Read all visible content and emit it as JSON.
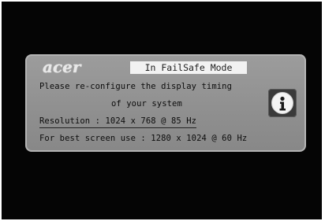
{
  "brand": {
    "logo_text": "acer"
  },
  "osd": {
    "mode_banner": "In FailSafe Mode",
    "message_line1": "Please re-configure the display timing",
    "message_line2": "of your system",
    "resolution_text": "Resolution : 1024 x 768 @ 85 Hz",
    "recommendation_text": "For best screen use : 1280 x 1024 @ 60 Hz"
  },
  "icons": {
    "info": "info-icon"
  },
  "colors": {
    "screen_background": "#050505",
    "dialog_background": "#949494",
    "banner_background": "#f2f2f2",
    "info_button_background": "#3a3a3a"
  }
}
